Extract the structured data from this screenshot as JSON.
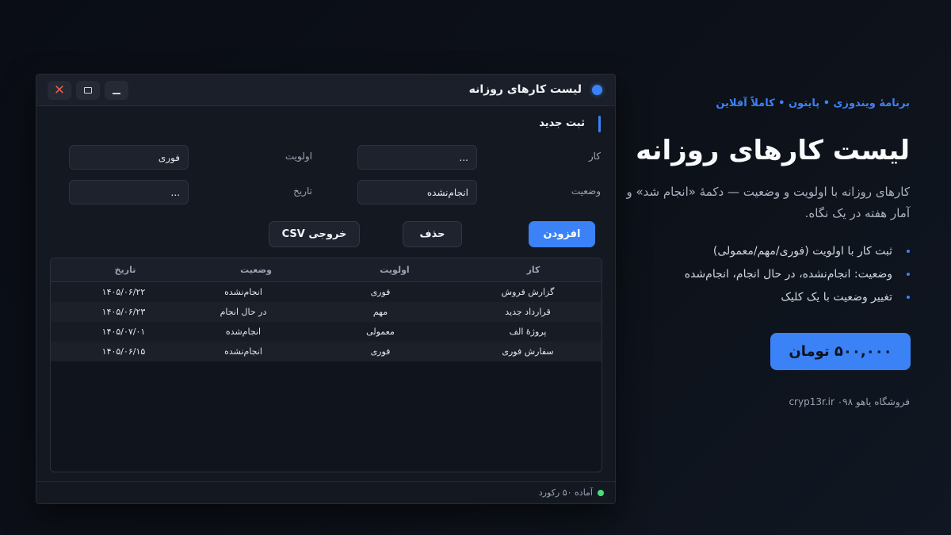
{
  "window": {
    "title": "لیست کارهای روزانه",
    "section_title": "ثبت جدید",
    "form": {
      "task_label": "کار",
      "task_placeholder": "...",
      "priority_label": "اولویت",
      "priority_value": "فوری",
      "status_label": "وضعیت",
      "status_value": "انجام‌نشده",
      "date_label": "تاریخ",
      "date_placeholder": "..."
    },
    "buttons": {
      "add": "افزودن",
      "delete": "حذف",
      "export": "خروجی CSV"
    },
    "table": {
      "headers": [
        "کار",
        "اولویت",
        "وضعیت",
        "تاریخ"
      ],
      "rows": [
        [
          "گزارش فروش",
          "فوری",
          "انجام‌نشده",
          "۱۴۰۵/۰۶/۲۲"
        ],
        [
          "قرارداد جدید",
          "مهم",
          "در حال انجام",
          "۱۴۰۵/۰۶/۲۳"
        ],
        [
          "پروژهٔ الف",
          "معمولی",
          "انجام‌شده",
          "۱۴۰۵/۰۷/۰۱"
        ],
        [
          "سفارش فوری",
          "فوری",
          "انجام‌نشده",
          "۱۴۰۵/۰۶/۱۵"
        ]
      ]
    },
    "status": "آماده ۵۰ رکورد"
  },
  "promo": {
    "tagline": "برنامهٔ ویندوزی • پایتون • کاملاً آفلاین",
    "headline": "لیست کارهای روزانه",
    "description": "کارهای روزانه با اولویت و وضعیت — دکمهٔ «انجام شد» و آمار هفته در یک نگاه.",
    "features": [
      "ثبت کار با اولویت (فوری/مهم/معمولی)",
      "وضعیت: انجام‌نشده، در حال انجام، انجام‌شده",
      "تغییر وضعیت با یک کلیک"
    ],
    "price": "۵۰۰,۰۰۰ تومان",
    "store": "فروشگاه یاهو ۰۹۸ cryp13r.ir"
  },
  "colors": {
    "accent": "#3b82f6",
    "background": "#0d1119",
    "window": "#141821",
    "close": "#e55b4d",
    "status_ok": "#4ade80"
  },
  "icons": [
    "close-icon",
    "maximize-icon",
    "minimize-icon",
    "app-dot-icon",
    "status-dot-icon"
  ]
}
